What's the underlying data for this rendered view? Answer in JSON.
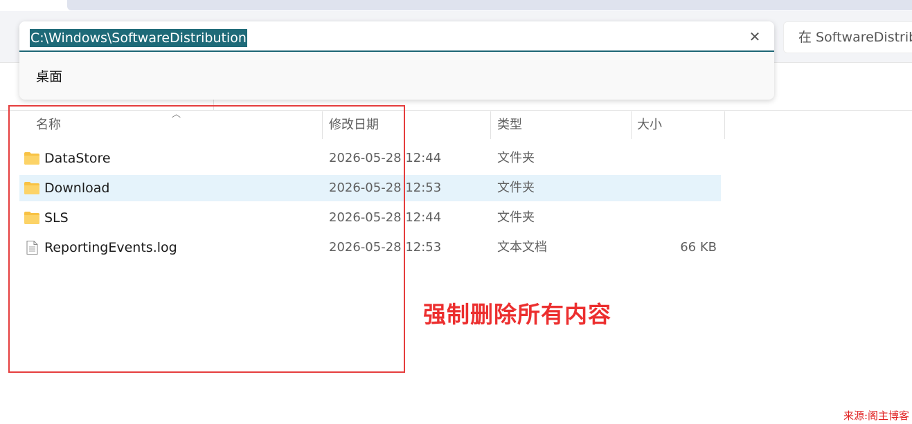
{
  "address_bar": {
    "path": "C:\\Windows\\SoftwareDistribution",
    "clear_icon": "close-icon",
    "suggestion": "桌面"
  },
  "search": {
    "placeholder": "在 SoftwareDistribution 中搜索"
  },
  "columns": {
    "name": "名称",
    "date": "修改日期",
    "type": "类型",
    "size": "大小"
  },
  "files": [
    {
      "name": "DataStore",
      "date": "2026-05-28 12:44",
      "type": "文件夹",
      "size": "",
      "icon": "folder-icon",
      "selected": false
    },
    {
      "name": "Download",
      "date": "2026-05-28 12:53",
      "type": "文件夹",
      "size": "",
      "icon": "folder-icon",
      "selected": true
    },
    {
      "name": "SLS",
      "date": "2026-05-28 12:44",
      "type": "文件夹",
      "size": "",
      "icon": "folder-icon",
      "selected": false
    },
    {
      "name": "ReportingEvents.log",
      "date": "2026-05-28 12:53",
      "type": "文本文档",
      "size": "66 KB",
      "icon": "text-file-icon",
      "selected": false
    }
  ],
  "annotation": {
    "text": "强制删除所有内容",
    "color": "#ec2f2f"
  },
  "watermark": "来源:阁主博客",
  "colors": {
    "accent": "#1e6a78",
    "selection": "#e5f3fb",
    "folder": "#f8c244"
  }
}
